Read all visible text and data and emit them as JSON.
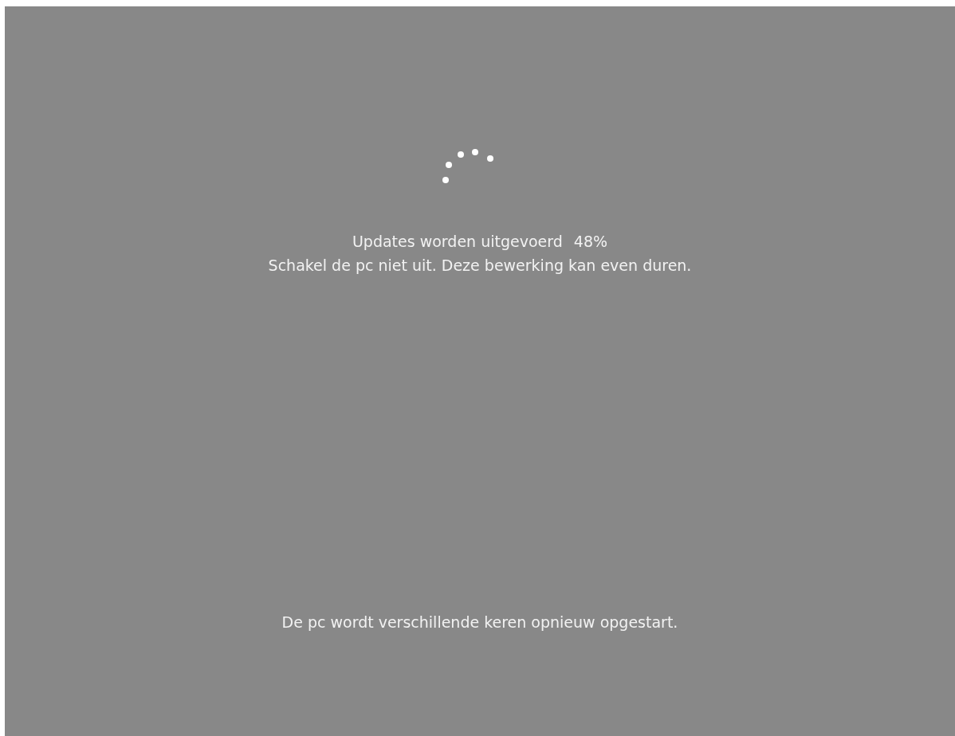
{
  "status": "Updates worden uitgevoerd",
  "percent": "48%",
  "warning": "Schakel de pc niet uit. Deze bewerking kan even duren.",
  "footer": "De pc wordt verschillende keren opnieuw opgestart."
}
